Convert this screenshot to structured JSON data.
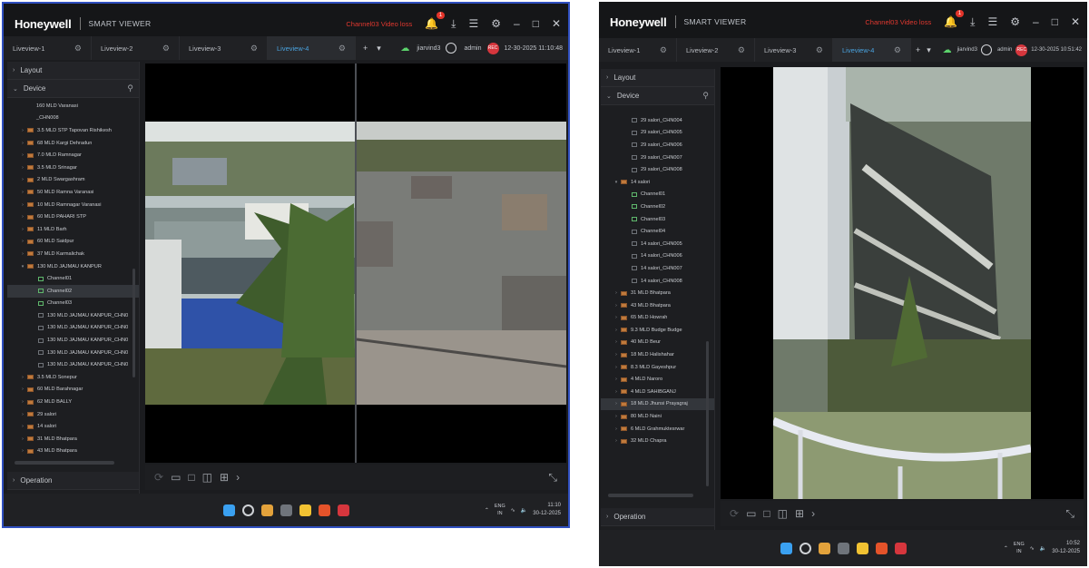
{
  "app": {
    "brand": "Honeywell",
    "name": "SMART VIEWER"
  },
  "left": {
    "notification": "Channel03 Video loss",
    "notification_count": "1",
    "tabs": [
      {
        "label": "Liveview-1"
      },
      {
        "label": "Liveview-2"
      },
      {
        "label": "Liveview-3"
      },
      {
        "label": "Liveview-4",
        "active": true
      }
    ],
    "user1": "jiarvind3",
    "user2": "admin",
    "rec": "REC",
    "datetime": "12-30-2025 11:10:48",
    "section_layout": "Layout",
    "section_device": "Device",
    "section_operation": "Operation",
    "tree": [
      {
        "label": "160 MLD Varanasi",
        "kind": "none",
        "indent": 2
      },
      {
        "label": "_CHN008",
        "kind": "none",
        "indent": 2
      },
      {
        "label": "3.5 MLD STP Tapovan Rishikesh",
        "kind": "nvr",
        "indent": 1
      },
      {
        "label": "68 MLD Kargi Dehradun",
        "kind": "nvr",
        "indent": 1
      },
      {
        "label": "7.0 MLD Ramnagar",
        "kind": "nvr",
        "indent": 1
      },
      {
        "label": "3.5 MLD Srinagar",
        "kind": "nvr",
        "indent": 1
      },
      {
        "label": "2 MLD Swargashram",
        "kind": "nvr",
        "indent": 1
      },
      {
        "label": "50 MLD Ramna Varanasi",
        "kind": "nvr",
        "indent": 1
      },
      {
        "label": "10 MLD Ramnagar Varanasi",
        "kind": "nvr",
        "indent": 1
      },
      {
        "label": "60 MLD PAHARI STP",
        "kind": "nvr",
        "indent": 1
      },
      {
        "label": "11 MLD Barh",
        "kind": "nvr",
        "indent": 1
      },
      {
        "label": "60 MLD Saidpur",
        "kind": "nvr",
        "indent": 1
      },
      {
        "label": "37 MLD Karmalichak",
        "kind": "nvr",
        "indent": 1
      },
      {
        "label": "130 MLD JAJMAU KANPUR",
        "kind": "nvr",
        "indent": 1,
        "expanded": true
      },
      {
        "label": "Channel01",
        "kind": "cam",
        "indent": 2
      },
      {
        "label": "Channel02",
        "kind": "cam",
        "indent": 2,
        "selected": true
      },
      {
        "label": "Channel03",
        "kind": "cam",
        "indent": 2
      },
      {
        "label": "130 MLD JAJMAU KANPUR_CHN0",
        "kind": "cam-off",
        "indent": 2
      },
      {
        "label": "130 MLD JAJMAU KANPUR_CHN0",
        "kind": "cam-off",
        "indent": 2
      },
      {
        "label": "130 MLD JAJMAU KANPUR_CHN0",
        "kind": "cam-off",
        "indent": 2
      },
      {
        "label": "130 MLD JAJMAU KANPUR_CHN0",
        "kind": "cam-off",
        "indent": 2
      },
      {
        "label": "130 MLD JAJMAU KANPUR_CHN0",
        "kind": "cam-off",
        "indent": 2
      },
      {
        "label": "3.5 MLD Sonepur",
        "kind": "nvr",
        "indent": 1
      },
      {
        "label": "60 MLD Barahnagar",
        "kind": "nvr",
        "indent": 1
      },
      {
        "label": "62 MLD BALLY",
        "kind": "nvr",
        "indent": 1
      },
      {
        "label": "29 salori",
        "kind": "nvr",
        "indent": 1
      },
      {
        "label": "14 salori",
        "kind": "nvr",
        "indent": 1
      },
      {
        "label": "31 MLD Bhatpara",
        "kind": "nvr",
        "indent": 1
      },
      {
        "label": "43 MLD Bhatpara",
        "kind": "nvr",
        "indent": 1
      }
    ],
    "taskbar_lang": [
      "ENG",
      "IN"
    ],
    "taskbar_time": "11:10",
    "taskbar_date": "30-12-2025"
  },
  "right": {
    "notification": "Channel03 Video loss",
    "notification_count": "1",
    "tabs": [
      {
        "label": "Liveview-1"
      },
      {
        "label": "Liveview-2"
      },
      {
        "label": "Liveview-3"
      },
      {
        "label": "Liveview-4",
        "active": true
      }
    ],
    "user1": "jiarvind3",
    "user2": "admin",
    "rec": "REC",
    "datetime": "12-30-2025 10:51:42",
    "section_layout": "Layout",
    "section_device": "Device",
    "section_operation": "Operation",
    "tree": [
      {
        "label": "29 salori_CHN004",
        "kind": "cam-off",
        "indent": 2
      },
      {
        "label": "29 salori_CHN005",
        "kind": "cam-off",
        "indent": 2
      },
      {
        "label": "29 salori_CHN006",
        "kind": "cam-off",
        "indent": 2
      },
      {
        "label": "29 salori_CHN007",
        "kind": "cam-off",
        "indent": 2
      },
      {
        "label": "29 salori_CHN008",
        "kind": "cam-off",
        "indent": 2
      },
      {
        "label": "14 salori",
        "kind": "nvr",
        "indent": 1,
        "expanded": true
      },
      {
        "label": "Channel01",
        "kind": "cam",
        "indent": 2
      },
      {
        "label": "Channel02",
        "kind": "cam",
        "indent": 2
      },
      {
        "label": "Channel03",
        "kind": "cam",
        "indent": 2
      },
      {
        "label": "Channel04",
        "kind": "cam-off",
        "indent": 2
      },
      {
        "label": "14 salori_CHN005",
        "kind": "cam-off",
        "indent": 2
      },
      {
        "label": "14 salori_CHN006",
        "kind": "cam-off",
        "indent": 2
      },
      {
        "label": "14 salori_CHN007",
        "kind": "cam-off",
        "indent": 2
      },
      {
        "label": "14 salori_CHN008",
        "kind": "cam-off",
        "indent": 2
      },
      {
        "label": "31 MLD Bhatpara",
        "kind": "nvr",
        "indent": 1
      },
      {
        "label": "43 MLD Bhatpara",
        "kind": "nvr",
        "indent": 1
      },
      {
        "label": "65 MLD Howrah",
        "kind": "nvr",
        "indent": 1
      },
      {
        "label": "9.3 MLD Budge Budge",
        "kind": "nvr",
        "indent": 1
      },
      {
        "label": "40 MLD Beur",
        "kind": "nvr",
        "indent": 1
      },
      {
        "label": "18 MLD Halishahar",
        "kind": "nvr",
        "indent": 1
      },
      {
        "label": "8.3 MLD Gayeshpur",
        "kind": "nvr",
        "indent": 1
      },
      {
        "label": "4 MLD Naroro",
        "kind": "nvr",
        "indent": 1
      },
      {
        "label": "4 MLD SAHIBGANJ",
        "kind": "nvr",
        "indent": 1
      },
      {
        "label": "18 MLD Jhunsi Prayagraj",
        "kind": "nvr",
        "indent": 1,
        "selected": true
      },
      {
        "label": "80 MLD Naini",
        "kind": "nvr",
        "indent": 1
      },
      {
        "label": "6 MLD Grahmuktesrwar",
        "kind": "nvr",
        "indent": 1
      },
      {
        "label": "32 MLD Chapra",
        "kind": "nvr",
        "indent": 1
      }
    ],
    "taskbar_lang": [
      "ENG",
      "IN"
    ],
    "taskbar_time": "10:52",
    "taskbar_date": "30-12-2025"
  },
  "colors": {
    "accent": "#4aa3df",
    "alert": "#e0382f",
    "frame": "#2f4fbf"
  }
}
